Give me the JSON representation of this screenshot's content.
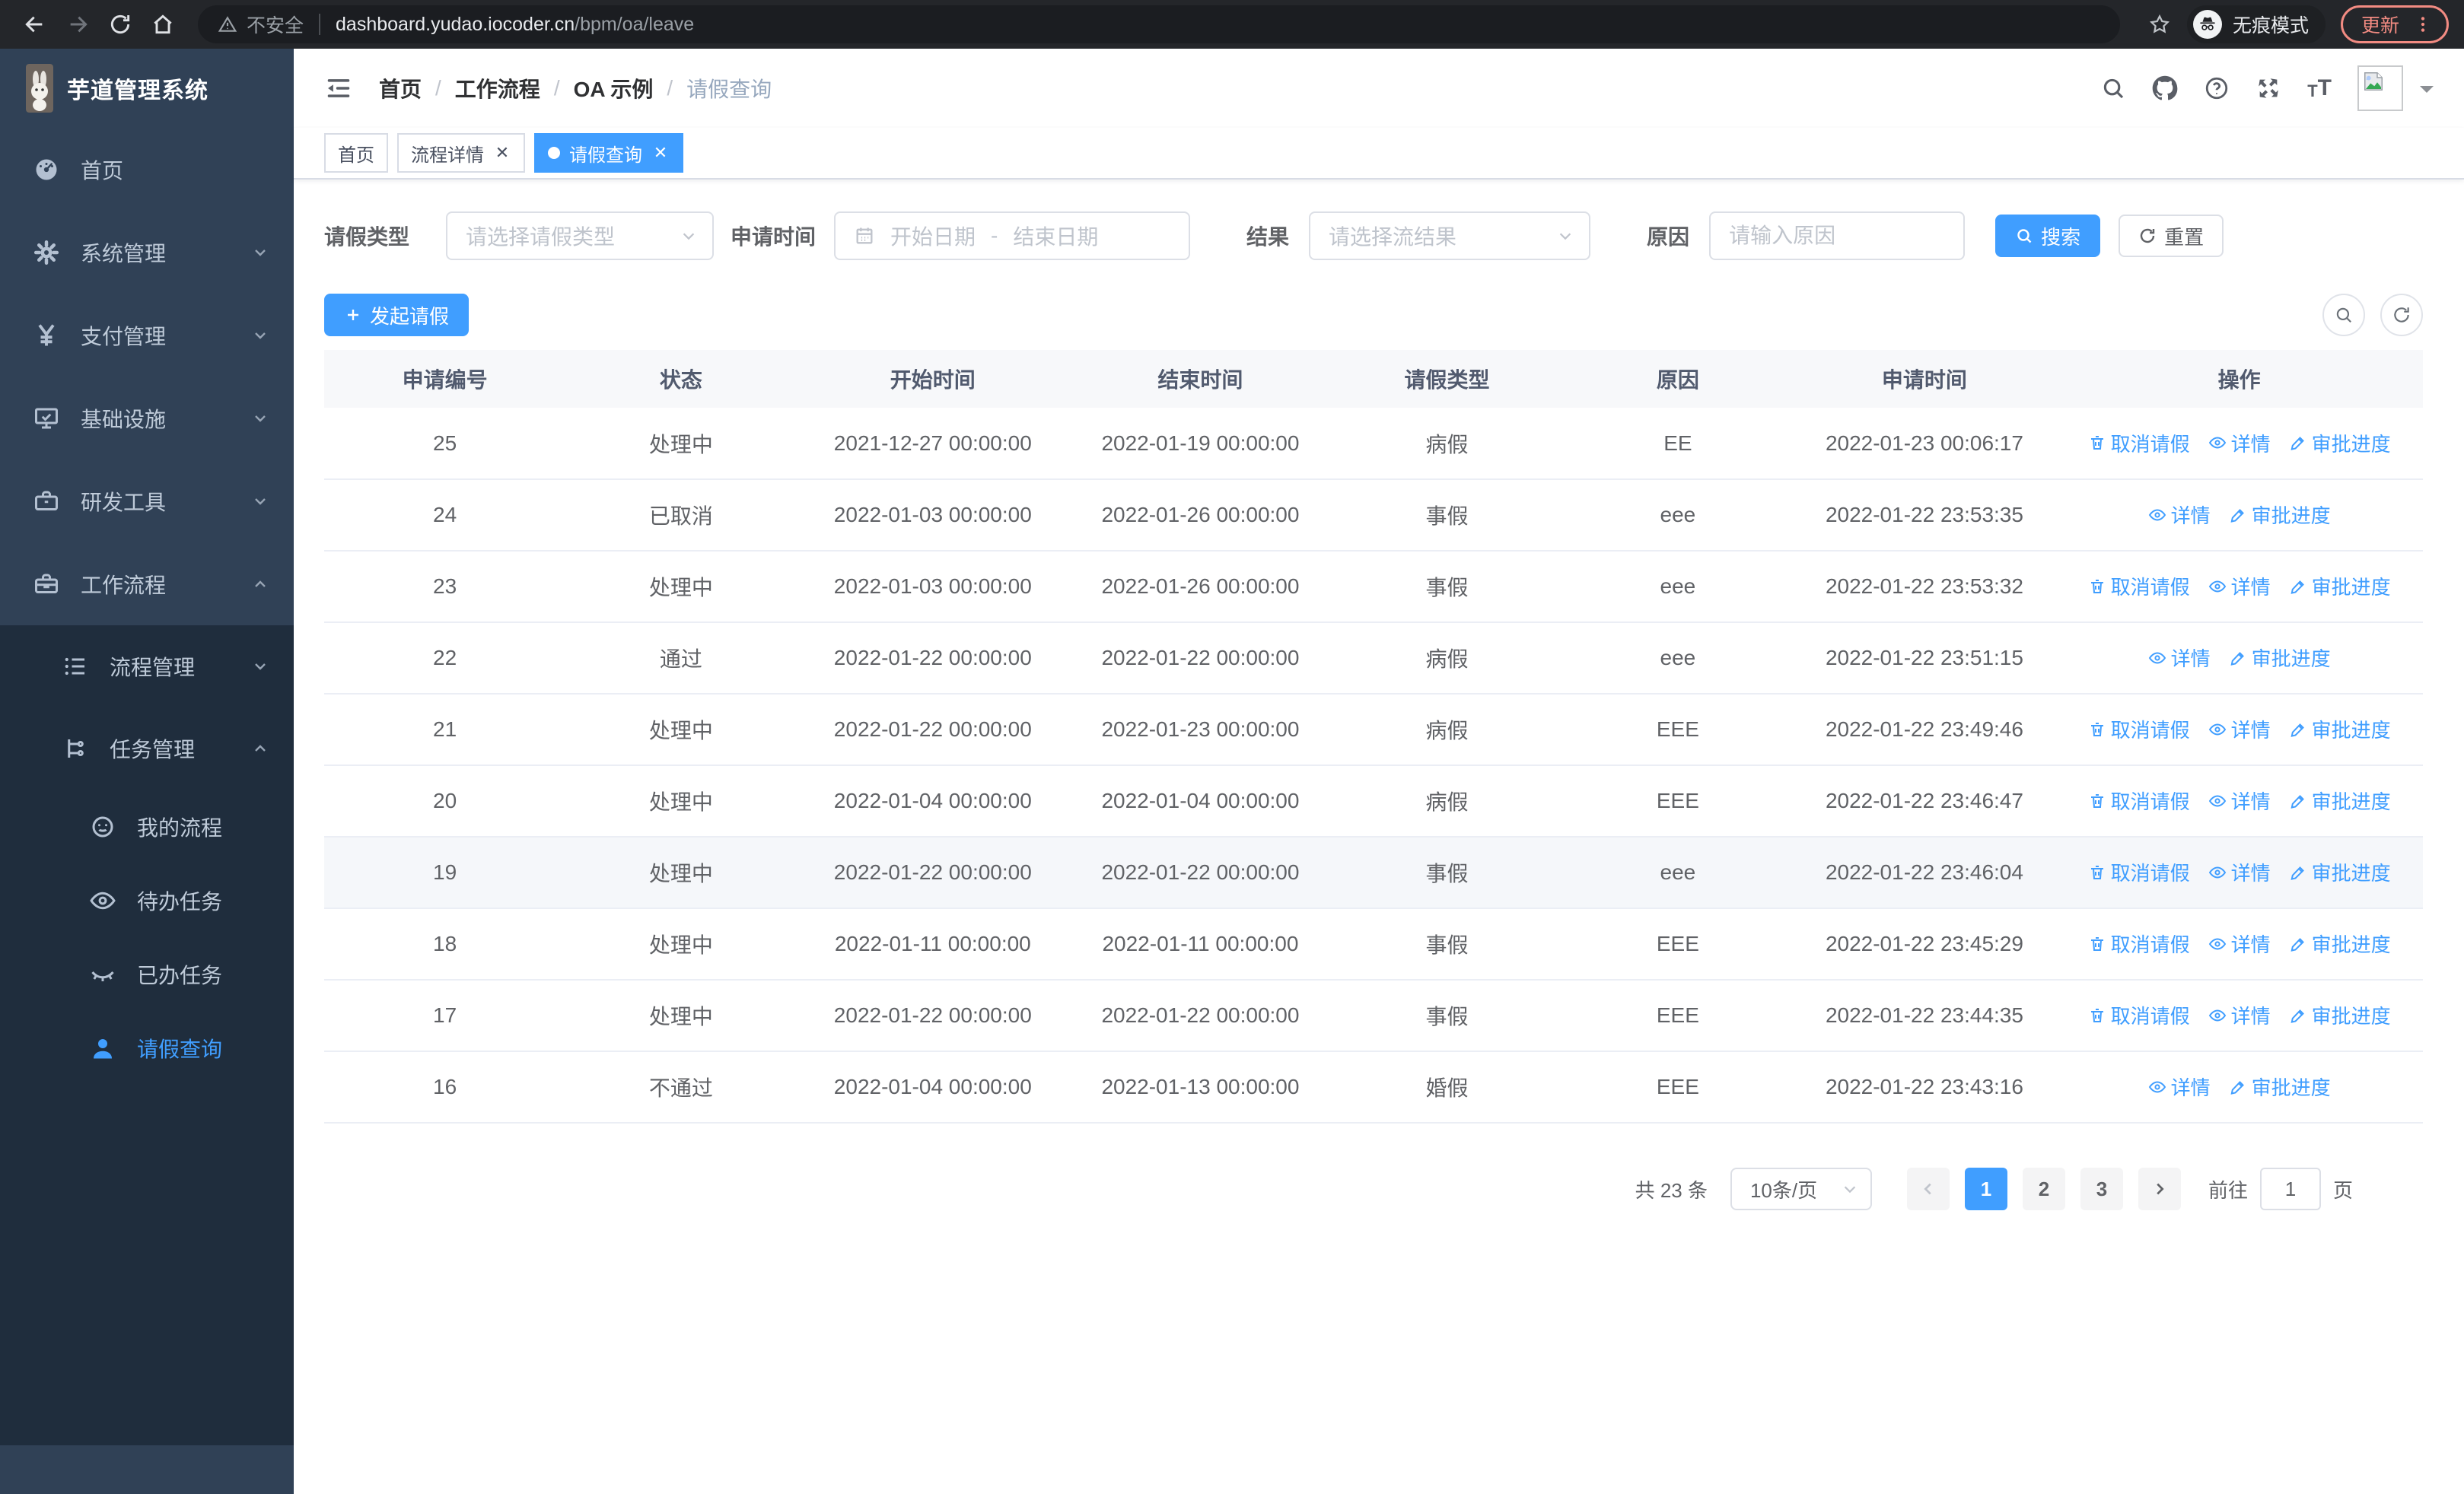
{
  "browser": {
    "security_label": "不安全",
    "url_host": "dashboard.yudao.iocoder.cn",
    "url_path": "/bpm/oa/leave",
    "incognito_label": "无痕模式",
    "update_label": "更新",
    "icons": [
      "back-icon",
      "forward-icon",
      "reload-icon",
      "home-icon",
      "warning-icon",
      "bookmark-star-icon",
      "incognito-icon",
      "kebab-menu-icon"
    ]
  },
  "sidebar": {
    "title": "芋道管理系统",
    "items": [
      {
        "label": "首页",
        "icon": "dashboard-icon",
        "arrow": null
      },
      {
        "label": "系统管理",
        "icon": "gear-icon",
        "arrow": "down"
      },
      {
        "label": "支付管理",
        "icon": "yen-icon",
        "arrow": "down"
      },
      {
        "label": "基础设施",
        "icon": "monitor-icon",
        "arrow": "down"
      },
      {
        "label": "研发工具",
        "icon": "toolbox-icon",
        "arrow": "down"
      },
      {
        "label": "工作流程",
        "icon": "briefcase-icon",
        "arrow": "up"
      }
    ],
    "submenu": [
      {
        "label": "流程管理",
        "icon": "list-tree-icon",
        "arrow": "down",
        "level": 1,
        "active": false
      },
      {
        "label": "任务管理",
        "icon": "branch-icon",
        "arrow": "up",
        "level": 1,
        "active": false
      },
      {
        "label": "我的流程",
        "icon": "face-icon",
        "arrow": null,
        "level": 2,
        "active": false
      },
      {
        "label": "待办任务",
        "icon": "eye-icon",
        "arrow": null,
        "level": 2,
        "active": false
      },
      {
        "label": "已办任务",
        "icon": "eye-closed-icon",
        "arrow": null,
        "level": 2,
        "active": false
      },
      {
        "label": "请假查询",
        "icon": "person-icon",
        "arrow": null,
        "level": 2,
        "active": true
      }
    ]
  },
  "header": {
    "breadcrumb": [
      "首页",
      "工作流程",
      "OA 示例",
      "请假查询"
    ],
    "icons": [
      "search-icon",
      "github-icon",
      "help-icon",
      "fullscreen-icon",
      "font-size-icon",
      "avatar-broken-image-icon",
      "caret-down-icon"
    ]
  },
  "tabs": [
    {
      "label": "首页",
      "closable": false,
      "active": false
    },
    {
      "label": "流程详情",
      "closable": true,
      "active": false
    },
    {
      "label": "请假查询",
      "closable": true,
      "active": true
    }
  ],
  "filters": {
    "leave_type_label": "请假类型",
    "leave_type_placeholder": "请选择请假类型",
    "apply_time_label": "申请时间",
    "date_start_placeholder": "开始日期",
    "date_separator": "-",
    "date_end_placeholder": "结束日期",
    "result_label": "结果",
    "result_placeholder": "请选择流结果",
    "reason_label": "原因",
    "reason_placeholder": "请输入原因",
    "search_label": "搜索",
    "reset_label": "重置"
  },
  "toolbar": {
    "create_label": "发起请假"
  },
  "table": {
    "headers": [
      "申请编号",
      "状态",
      "开始时间",
      "结束时间",
      "请假类型",
      "原因",
      "申请时间",
      "操作"
    ],
    "actions": {
      "cancel": {
        "label": "取消请假",
        "icon": "trash-icon"
      },
      "detail": {
        "label": "详情",
        "icon": "eye-icon"
      },
      "progress": {
        "label": "审批进度",
        "icon": "pencil-icon"
      }
    },
    "rows": [
      {
        "id": "25",
        "status": "处理中",
        "start": "2021-12-27 00:00:00",
        "end": "2022-01-19 00:00:00",
        "type": "病假",
        "reason": "EE",
        "applied": "2022-01-23 00:06:17",
        "can_cancel": true,
        "highlight": false
      },
      {
        "id": "24",
        "status": "已取消",
        "start": "2022-01-03 00:00:00",
        "end": "2022-01-26 00:00:00",
        "type": "事假",
        "reason": "eee",
        "applied": "2022-01-22 23:53:35",
        "can_cancel": false,
        "highlight": false
      },
      {
        "id": "23",
        "status": "处理中",
        "start": "2022-01-03 00:00:00",
        "end": "2022-01-26 00:00:00",
        "type": "事假",
        "reason": "eee",
        "applied": "2022-01-22 23:53:32",
        "can_cancel": true,
        "highlight": false
      },
      {
        "id": "22",
        "status": "通过",
        "start": "2022-01-22 00:00:00",
        "end": "2022-01-22 00:00:00",
        "type": "病假",
        "reason": "eee",
        "applied": "2022-01-22 23:51:15",
        "can_cancel": false,
        "highlight": false
      },
      {
        "id": "21",
        "status": "处理中",
        "start": "2022-01-22 00:00:00",
        "end": "2022-01-23 00:00:00",
        "type": "病假",
        "reason": "EEE",
        "applied": "2022-01-22 23:49:46",
        "can_cancel": true,
        "highlight": false
      },
      {
        "id": "20",
        "status": "处理中",
        "start": "2022-01-04 00:00:00",
        "end": "2022-01-04 00:00:00",
        "type": "病假",
        "reason": "EEE",
        "applied": "2022-01-22 23:46:47",
        "can_cancel": true,
        "highlight": false
      },
      {
        "id": "19",
        "status": "处理中",
        "start": "2022-01-22 00:00:00",
        "end": "2022-01-22 00:00:00",
        "type": "事假",
        "reason": "eee",
        "applied": "2022-01-22 23:46:04",
        "can_cancel": true,
        "highlight": true
      },
      {
        "id": "18",
        "status": "处理中",
        "start": "2022-01-11 00:00:00",
        "end": "2022-01-11 00:00:00",
        "type": "事假",
        "reason": "EEE",
        "applied": "2022-01-22 23:45:29",
        "can_cancel": true,
        "highlight": false
      },
      {
        "id": "17",
        "status": "处理中",
        "start": "2022-01-22 00:00:00",
        "end": "2022-01-22 00:00:00",
        "type": "事假",
        "reason": "EEE",
        "applied": "2022-01-22 23:44:35",
        "can_cancel": true,
        "highlight": false
      },
      {
        "id": "16",
        "status": "不通过",
        "start": "2022-01-04 00:00:00",
        "end": "2022-01-13 00:00:00",
        "type": "婚假",
        "reason": "EEE",
        "applied": "2022-01-22 23:43:16",
        "can_cancel": false,
        "highlight": false
      }
    ]
  },
  "pagination": {
    "total_label": "共 23 条",
    "page_size": "10条/页",
    "pages": [
      "1",
      "2",
      "3"
    ],
    "active_page": "1",
    "goto_label": "前往",
    "goto_value": "1",
    "page_suffix": "页"
  },
  "colors": {
    "accent": "#409eff",
    "sidebar_bg": "#304156",
    "submenu_bg": "#1f2d3d",
    "update_accent": "#f28b82"
  }
}
